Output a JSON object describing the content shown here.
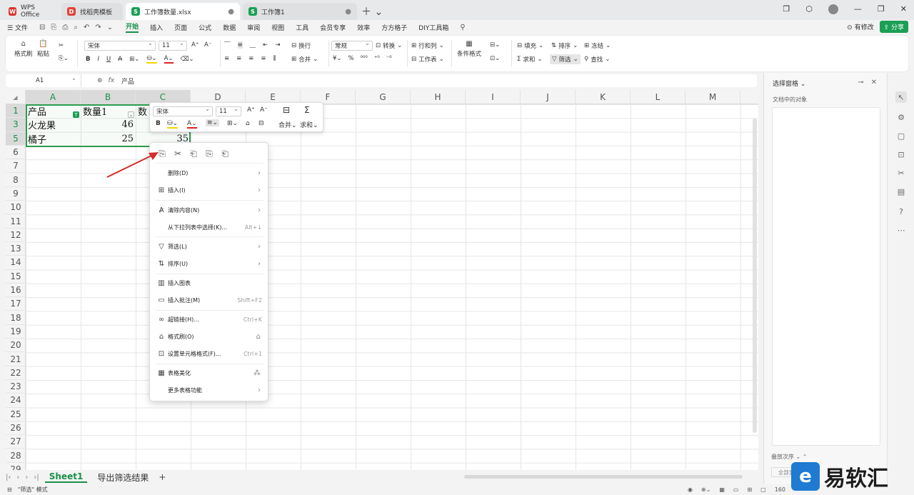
{
  "tabs": [
    {
      "label": "WPS Office",
      "logo": "W"
    },
    {
      "label": "找稻壳模板",
      "logo": "D"
    },
    {
      "label": "工作簿数量.xlsx",
      "logo": "S"
    },
    {
      "label": "工作簿1",
      "logo": "S"
    }
  ],
  "menu": {
    "file": "文件",
    "items": [
      "开始",
      "插入",
      "页面",
      "公式",
      "数据",
      "审阅",
      "视图",
      "工具",
      "会员专享",
      "效率",
      "方方格子",
      "DIY工具箱"
    ],
    "has_changes": "有修改",
    "share": "分享"
  },
  "ribbon": {
    "format_painter": "格式刷",
    "paste": "粘贴",
    "font": "宋体",
    "size": "11",
    "number_format": "常规",
    "convert": "转换",
    "wrap": "换行",
    "merge": "合并",
    "row_col": "行和列",
    "worksheet": "工作表",
    "cond_format": "条件格式",
    "fill": "填充",
    "sort": "排序",
    "freeze": "冻结",
    "sum": "求和",
    "filter": "筛选",
    "find": "查找"
  },
  "formula_bar": {
    "cell_ref": "A1",
    "fx": "fx",
    "value": "产品"
  },
  "columns": [
    "A",
    "B",
    "C",
    "D",
    "E",
    "F",
    "G",
    "H",
    "I",
    "J",
    "K",
    "L",
    "M"
  ],
  "rows": [
    "1",
    "3",
    "5",
    "6",
    "7",
    "8",
    "9",
    "10",
    "11",
    "12",
    "13",
    "14",
    "15",
    "16",
    "17",
    "18",
    "19",
    "20",
    "21",
    "22",
    "23",
    "24",
    "25",
    "26",
    "27",
    "28",
    "29"
  ],
  "cells": {
    "a1": "产品",
    "b1": "数量1",
    "c1": "数",
    "a3": "火龙果",
    "b3": "46",
    "a5": "橘子",
    "b5": "25",
    "c5": "35"
  },
  "mini_toolbar": {
    "font": "宋体",
    "size": "11",
    "merge": "合并",
    "sum": "求和"
  },
  "context_menu": [
    {
      "label": "删除(D)",
      "icon": "",
      "shortcut": "",
      "arrow": "›"
    },
    {
      "label": "插入(I)",
      "icon": "⊞",
      "shortcut": "",
      "arrow": "›"
    },
    {
      "label": "清除内容(N)",
      "icon": "A̷",
      "shortcut": "",
      "arrow": "›"
    },
    {
      "label": "从下拉列表中选择(K)...",
      "icon": "",
      "shortcut": "Alt+↓",
      "arrow": ""
    },
    {
      "label": "筛选(L)",
      "icon": "▽",
      "shortcut": "",
      "arrow": "›"
    },
    {
      "label": "排序(U)",
      "icon": "⇅",
      "shortcut": "",
      "arrow": "›"
    },
    {
      "label": "插入图表",
      "icon": "▥",
      "shortcut": "",
      "arrow": ""
    },
    {
      "label": "插入批注(M)",
      "icon": "▭",
      "shortcut": "Shift+F2",
      "arrow": ""
    },
    {
      "label": "超链接(H)...",
      "icon": "∞",
      "shortcut": "Ctrl+K",
      "arrow": ""
    },
    {
      "label": "格式刷(O)",
      "icon": "⌂",
      "shortcut": "",
      "arrow": ""
    },
    {
      "label": "设置单元格格式(F)...",
      "icon": "⊡",
      "shortcut": "Ctrl+1",
      "arrow": ""
    },
    {
      "label": "表格美化",
      "icon": "▦",
      "shortcut": "",
      "arrow": ""
    },
    {
      "label": "更多表格功能",
      "icon": "",
      "shortcut": "",
      "arrow": "›"
    }
  ],
  "sheet_tabs": [
    "Sheet1",
    "导出筛选结果"
  ],
  "status": {
    "mode": "\"筛选\" 模式",
    "zoom": "160"
  },
  "pane": {
    "title": "选择窗格",
    "sub": "文档中的对象",
    "order": "叠放次序",
    "show_all": "全部显"
  },
  "watermark": {
    "logo": "e",
    "text": "易软汇"
  },
  "colors": {
    "accent": "#1a8f4a",
    "selection": "#2e9b4f",
    "arrow": "#d62b2b"
  }
}
